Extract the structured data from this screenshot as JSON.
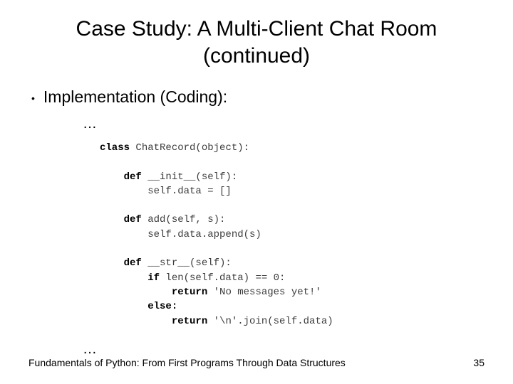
{
  "title_line1": "Case Study: A Multi-Client Chat Room",
  "title_line2": "(continued)",
  "bullet": "Implementation (Coding):",
  "ellipsis": "…",
  "code": {
    "l1a": "class",
    "l1b": " ChatRecord(object):",
    "l2a": "    def",
    "l2b": " __init__(self):",
    "l3": "        self.data = []",
    "l4a": "    def",
    "l4b": " add(self, s):",
    "l5": "        self.data.append(s)",
    "l6a": "    def",
    "l6b": " __str__(self):",
    "l7a": "        if",
    "l7b": " len(self.data) == 0:",
    "l8a": "            return",
    "l8b": " 'No messages yet!'",
    "l9": "        else:",
    "l10a": "            return",
    "l10b": " '\\n'.join(self.data)"
  },
  "footer_left": "Fundamentals of Python: From First Programs Through Data Structures",
  "footer_right": "35"
}
